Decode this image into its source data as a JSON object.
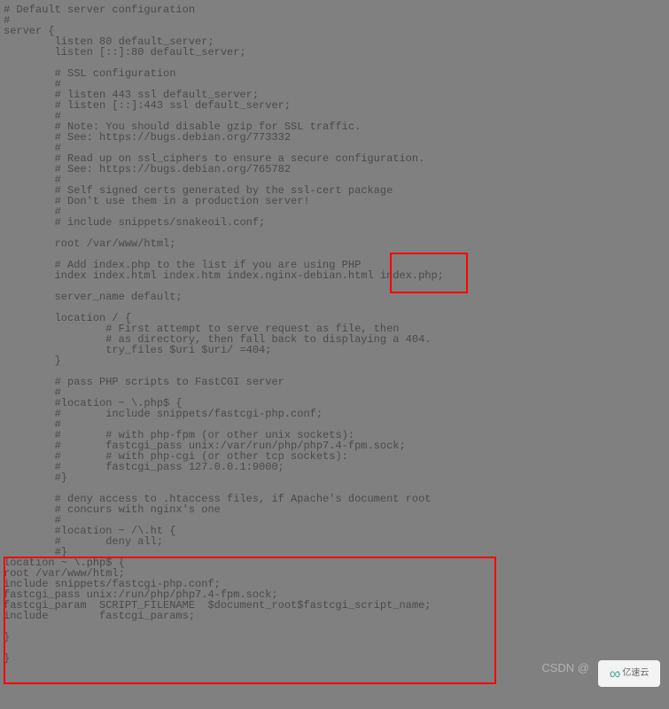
{
  "config_text": "# Default server configuration\n#\nserver {\n        listen 80 default_server;\n        listen [::]:80 default_server;\n\n        # SSL configuration\n        #\n        # listen 443 ssl default_server;\n        # listen [::]:443 ssl default_server;\n        #\n        # Note: You should disable gzip for SSL traffic.\n        # See: https://bugs.debian.org/773332\n        #\n        # Read up on ssl_ciphers to ensure a secure configuration.\n        # See: https://bugs.debian.org/765782\n        #\n        # Self signed certs generated by the ssl-cert package\n        # Don't use them in a production server!\n        #\n        # include snippets/snakeoil.conf;\n\n        root /var/www/html;\n\n        # Add index.php to the list if you are using PHP\n        index index.html index.htm index.nginx-debian.html index.php;\n\n        server_name default;\n\n        location / {\n                # First attempt to serve request as file, then\n                # as directory, then fall back to displaying a 404.\n                try_files $uri $uri/ =404;\n        }\n\n        # pass PHP scripts to FastCGI server\n        #\n        #location ~ \\.php$ {\n        #       include snippets/fastcgi-php.conf;\n        #\n        #       # with php-fpm (or other unix sockets):\n        #       fastcgi_pass unix:/var/run/php/php7.4-fpm.sock;\n        #       # with php-cgi (or other tcp sockets):\n        #       fastcgi_pass 127.0.0.1:9000;\n        #}\n\n        # deny access to .htaccess files, if Apache's document root\n        # concurs with nginx's one\n        #\n        #location ~ /\\.ht {\n        #       deny all;\n        #}\nlocation ~ \\.php$ {\nroot /var/www/html;\ninclude snippets/fastcgi-php.conf;\nfastcgi_pass unix:/run/php/php7.4-fpm.sock;\nfastcgi_param  SCRIPT_FILENAME  $document_root$fastcgi_script_name;\ninclude        fastcgi_params;\n\n}\n\n}",
  "highlight_1_text": "index.php;",
  "highlight_2_description": "PHP location block configuration",
  "watermark_csdn": "CSDN @",
  "watermark_logo": "亿速云"
}
